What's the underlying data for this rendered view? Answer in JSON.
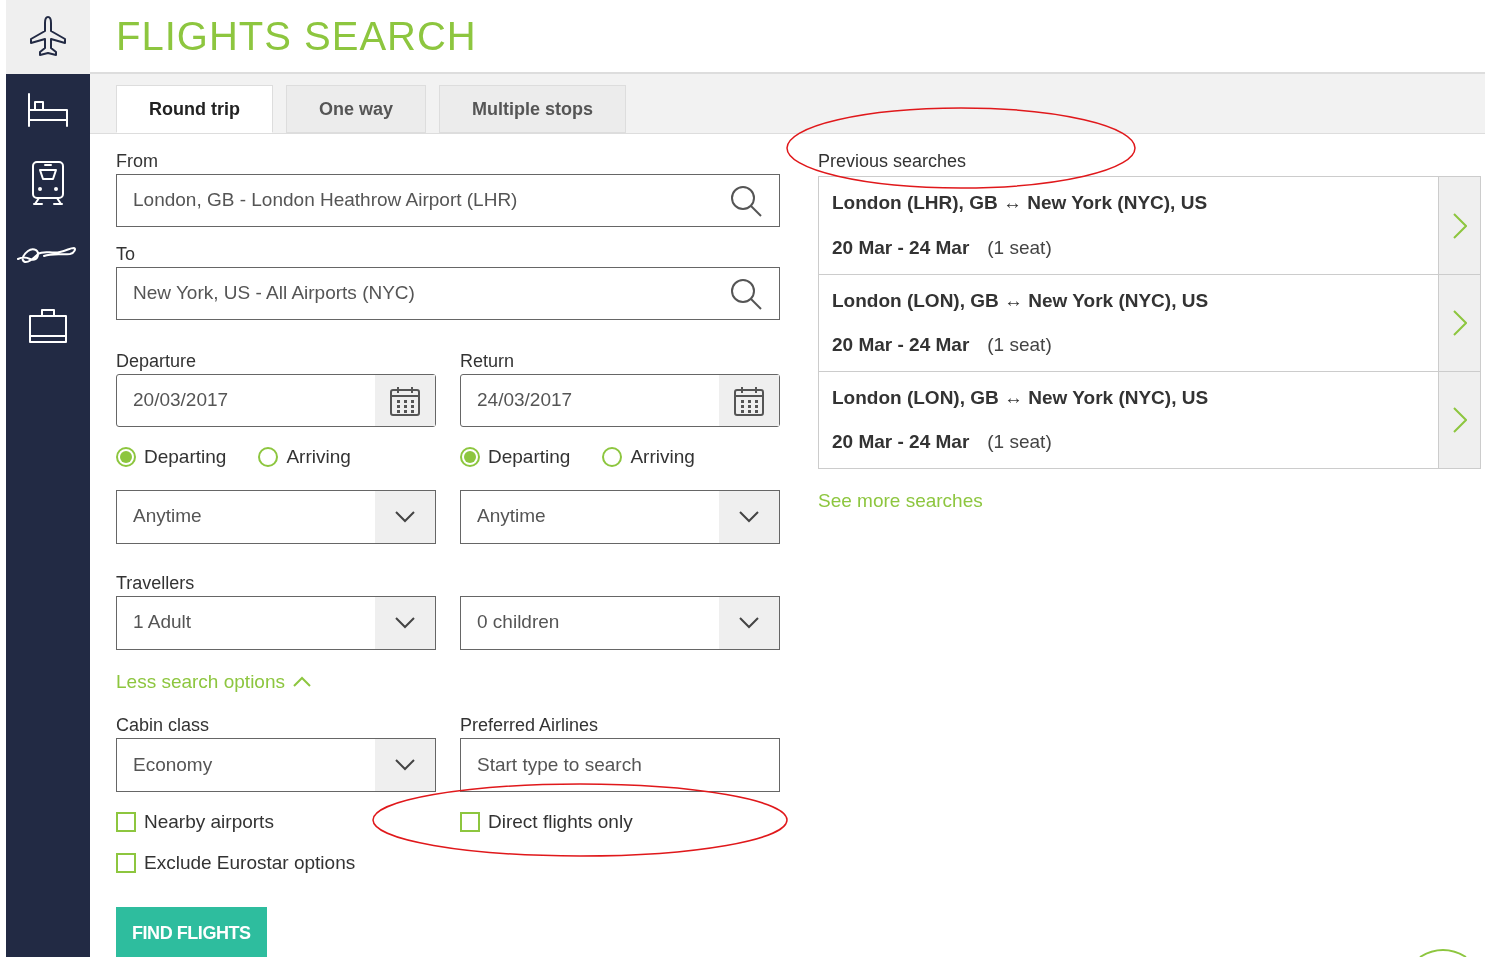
{
  "sidebar": {
    "items": [
      {
        "kind": "plane",
        "selected": true
      },
      {
        "kind": "bed",
        "selected": false
      },
      {
        "kind": "train",
        "selected": false
      },
      {
        "kind": "car",
        "selected": false
      },
      {
        "kind": "case",
        "selected": false
      }
    ]
  },
  "title": "FLIGHTS SEARCH",
  "tabs": [
    {
      "label": "Round trip",
      "selected": true
    },
    {
      "label": "One way",
      "selected": false
    },
    {
      "label": "Multiple stops",
      "selected": false
    }
  ],
  "from": {
    "label": "From",
    "value": "London, GB - London Heathrow Airport (LHR)"
  },
  "to": {
    "label": "To",
    "value": "New York, US - All Airports (NYC)"
  },
  "dates": [
    {
      "label": "Departure",
      "value": "20/03/2017",
      "options": [
        {
          "label": "Departing",
          "selected": true
        },
        {
          "label": "Arriving",
          "selected": false
        }
      ],
      "time": "Anytime"
    },
    {
      "label": "Return",
      "value": "24/03/2017",
      "options": [
        {
          "label": "Departing",
          "selected": true
        },
        {
          "label": "Arriving",
          "selected": false
        }
      ],
      "time": "Anytime"
    }
  ],
  "travellers": {
    "label": "Travellers",
    "adults": "1 Adult",
    "children": "0 children"
  },
  "less_options": "Less search options",
  "cabin": {
    "label": "Cabin class",
    "value": "Economy"
  },
  "airlines": {
    "label": "Preferred Airlines",
    "placeholder": "Start type to search"
  },
  "checkboxes": [
    {
      "label": "Nearby airports",
      "checked": false
    },
    {
      "label": "Direct flights only",
      "checked": false
    },
    {
      "label": "Exclude Eurostar options",
      "checked": false
    }
  ],
  "find_button": "FIND FLIGHTS",
  "previous": {
    "title": "Previous searches",
    "items": [
      {
        "route": "London (LHR), GB ↔ New York (NYC), US",
        "dates": "20 Mar - 24 Mar",
        "seats": "(1 seat)"
      },
      {
        "route": "London (LON), GB ↔ New York (NYC), US",
        "dates": "20 Mar - 24 Mar",
        "seats": "(1 seat)"
      },
      {
        "route": "London (LON), GB ↔ New York (NYC), US",
        "dates": "20 Mar - 24 Mar",
        "seats": "(1 seat)"
      }
    ],
    "more": "See more searches"
  }
}
